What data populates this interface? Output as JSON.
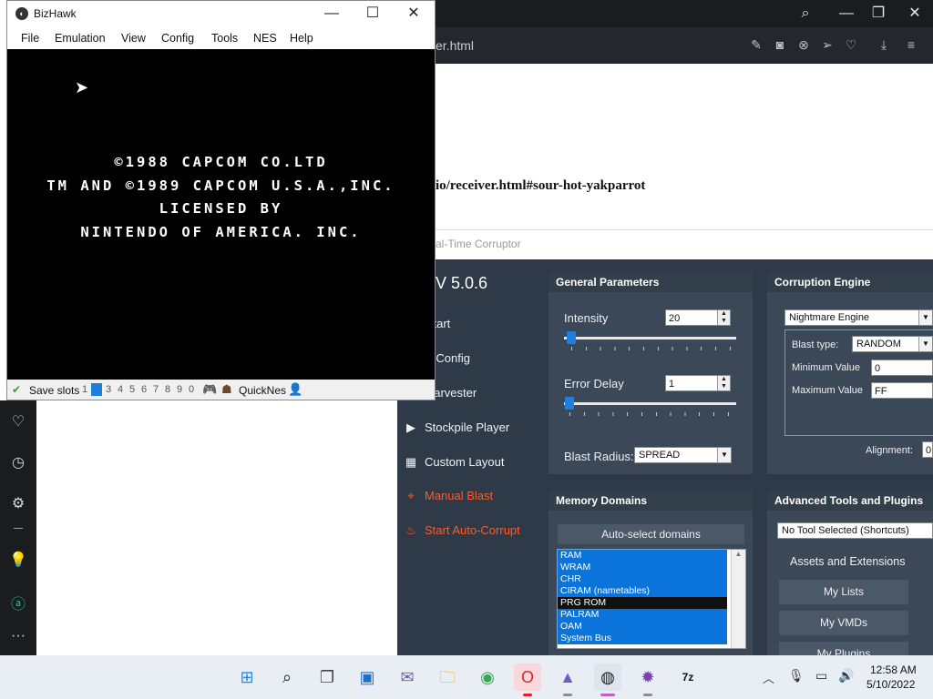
{
  "browser": {
    "url_fragment": "er.html",
    "page_text": "io/receiver.html#sour-hot-yakparrot",
    "topbar_icons": [
      "search-icon",
      "minimize-icon",
      "restore-icon",
      "close-icon"
    ],
    "toolbar_icons": [
      "edit-icon",
      "camera-icon",
      "block-icon",
      "send-icon",
      "heart-icon",
      "download-icon",
      "menu-icon"
    ],
    "sidebar_icons": [
      "heart-icon",
      "clock-icon",
      "gear-icon",
      "lightbulb-icon",
      "aria-icon",
      "more-icon"
    ]
  },
  "bizhawk": {
    "title": "BizHawk",
    "menu": [
      "File",
      "Emulation",
      "View",
      "Config",
      "Tools",
      "NES",
      "Help"
    ],
    "screen_lines": [
      "©1988 CAPCOM CO.LTD",
      "TM AND ©1989 CAPCOM U.S.A.,INC.",
      "LICENSED BY",
      "NINTENDO OF AMERICA. INC."
    ],
    "status": {
      "save_slots_label": "Save slots",
      "slots": [
        "1",
        "2",
        "3",
        "4",
        "5",
        "6",
        "7",
        "8",
        "9",
        "0"
      ],
      "current_slot": "2",
      "core": "QuickNes"
    }
  },
  "rtc": {
    "title": "al-Time Corruptor",
    "version": "V 5.0.6",
    "menu": [
      {
        "label": "asy Start",
        "icon": ""
      },
      {
        "label": "ngine Config",
        "icon": ""
      },
      {
        "label": "itch Harvester",
        "icon": ""
      },
      {
        "label": "Stockpile Player",
        "icon": "play-icon"
      },
      {
        "label": "Custom Layout",
        "icon": "grid-icon"
      },
      {
        "label": "Manual Blast",
        "icon": "crosshair-icon"
      },
      {
        "label": "Start Auto-Corrupt",
        "icon": "flame-icon"
      }
    ],
    "general": {
      "header": "General Parameters",
      "intensity_label": "Intensity",
      "intensity_value": "20",
      "error_delay_label": "Error Delay",
      "error_delay_value": "1",
      "blast_radius_label": "Blast Radius:",
      "blast_radius_value": "SPREAD"
    },
    "engine": {
      "header": "Corruption Engine",
      "engine_value": "Nightmare Engine",
      "blast_type_label": "Blast type:",
      "blast_type_value": "RANDOM",
      "min_label": "Minimum Value",
      "min_value": "0",
      "max_label": "Maximum Value",
      "max_value": "FF",
      "alignment_label": "Alignment:",
      "alignment_value": "0"
    },
    "memory": {
      "header": "Memory Domains",
      "auto_select": "Auto-select domains",
      "domains": [
        {
          "name": "RAM",
          "selected": true
        },
        {
          "name": "WRAM",
          "selected": true
        },
        {
          "name": "CHR",
          "selected": true
        },
        {
          "name": "CIRAM (nametables)",
          "selected": true
        },
        {
          "name": "PRG ROM",
          "selected": false
        },
        {
          "name": "PALRAM",
          "selected": true
        },
        {
          "name": "OAM",
          "selected": true
        },
        {
          "name": "System Bus",
          "selected": true
        }
      ]
    },
    "advanced": {
      "header": "Advanced Tools and Plugins",
      "tool_select": "No Tool Selected (Shortcuts)",
      "assets_label": "Assets and Extensions",
      "buttons": [
        "My Lists",
        "My VMDs",
        "My Plugins"
      ]
    }
  },
  "taskbar": {
    "apps": [
      "windows-start-icon",
      "search-icon",
      "task-view-icon",
      "widgets-icon",
      "teams-chat-icon",
      "file-explorer-icon",
      "chrome-icon",
      "opera-icon",
      "app-icon",
      "rtc-icon",
      "game-icon",
      "7zip-icon"
    ],
    "time": "12:58 AM",
    "date": "5/10/2022"
  }
}
